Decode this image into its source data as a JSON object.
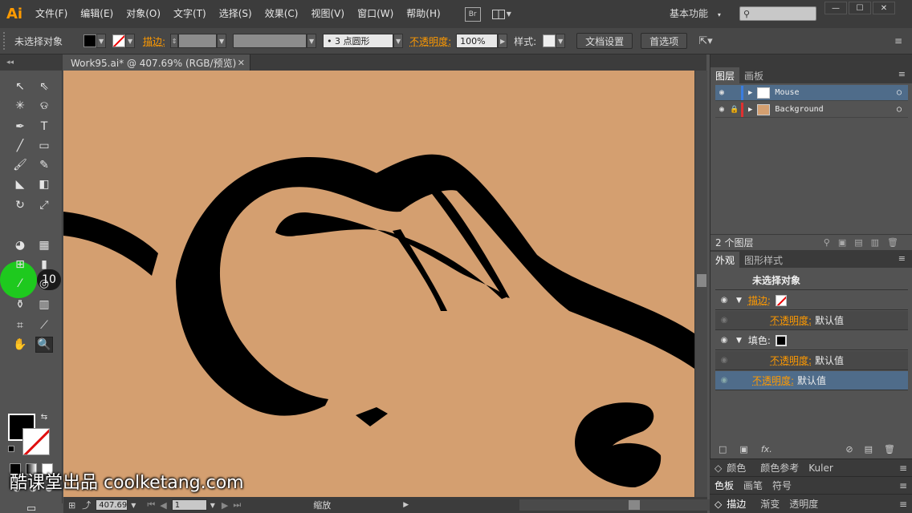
{
  "app": {
    "logo": "Ai"
  },
  "menu": {
    "items": [
      "文件(F)",
      "编辑(E)",
      "对象(O)",
      "文字(T)",
      "选择(S)",
      "效果(C)",
      "视图(V)",
      "窗口(W)",
      "帮助(H)"
    ],
    "bridge": "Br",
    "workspace": "基本功能",
    "window_buttons": [
      "—",
      "☐",
      "✕"
    ]
  },
  "control": {
    "selection": "未选择对象",
    "stroke_label": "描边:",
    "brush": "•  3 点圆形",
    "opacity_label": "不透明度:",
    "opacity_value": "100%",
    "style_label": "样式:",
    "doc_settings": "文档设置",
    "preferences": "首选项"
  },
  "document": {
    "tab": "Work95.ai* @ 407.69% (RGB/预览)",
    "close": "✕"
  },
  "toolbar": {
    "badge": "10"
  },
  "status": {
    "zoom": "407.69",
    "page": "1",
    "label": "缩放"
  },
  "layers_panel": {
    "tabs": [
      "图层",
      "画板"
    ],
    "layers": [
      {
        "name": "Mouse",
        "color": "#3a7de0",
        "selected": true
      },
      {
        "name": "Background",
        "color": "#e03030",
        "selected": false
      }
    ],
    "count": "2 个图层"
  },
  "appearance_panel": {
    "tabs": [
      "外观",
      "图形样式"
    ],
    "title": "未选择对象",
    "stroke": "描边:",
    "opacity": "不透明度:",
    "default": "默认值",
    "fill": "填色:",
    "fx": "fx."
  },
  "collapsed_panels": {
    "row1": [
      "颜色",
      "颜色参考",
      "Kuler"
    ],
    "row2": [
      "色板",
      "画笔",
      "符号"
    ],
    "row3": [
      "描边",
      "渐变",
      "透明度"
    ]
  },
  "colors": {
    "artboard": "#d49f70",
    "accent": "#ff9a00",
    "selection": "#4f6c8a"
  },
  "watermark": "酷课堂出品 coolketang.com"
}
